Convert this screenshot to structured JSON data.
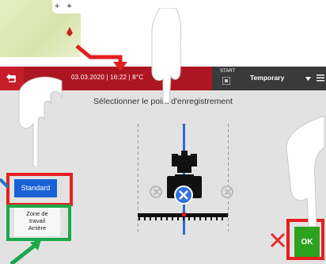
{
  "map": {
    "controls": [
      "+",
      "⌖"
    ],
    "pin_icon": "map-pin-icon"
  },
  "topbar": {
    "datetime": "03.03.2020 | 16:22 | 8°C",
    "start_label": "START",
    "profile_label": "Temporary",
    "back_icon": "back-arrow-icon",
    "menu_icon": "hamburger-menu-icon"
  },
  "screen": {
    "title": "Sélectionner le point d'enregistrement"
  },
  "buttons": {
    "standard": "Standard",
    "zone_lines": [
      "Zone de",
      "travail",
      "Arrière"
    ],
    "ok": "OK",
    "cancel_icon": "close-icon"
  },
  "colors": {
    "topbar": "#ad1621",
    "selected": "#1862d6",
    "ok": "#2ca21f",
    "cancel": "#e52b2b",
    "highlight_red": "#e41f1f",
    "highlight_green": "#1aa84a"
  }
}
